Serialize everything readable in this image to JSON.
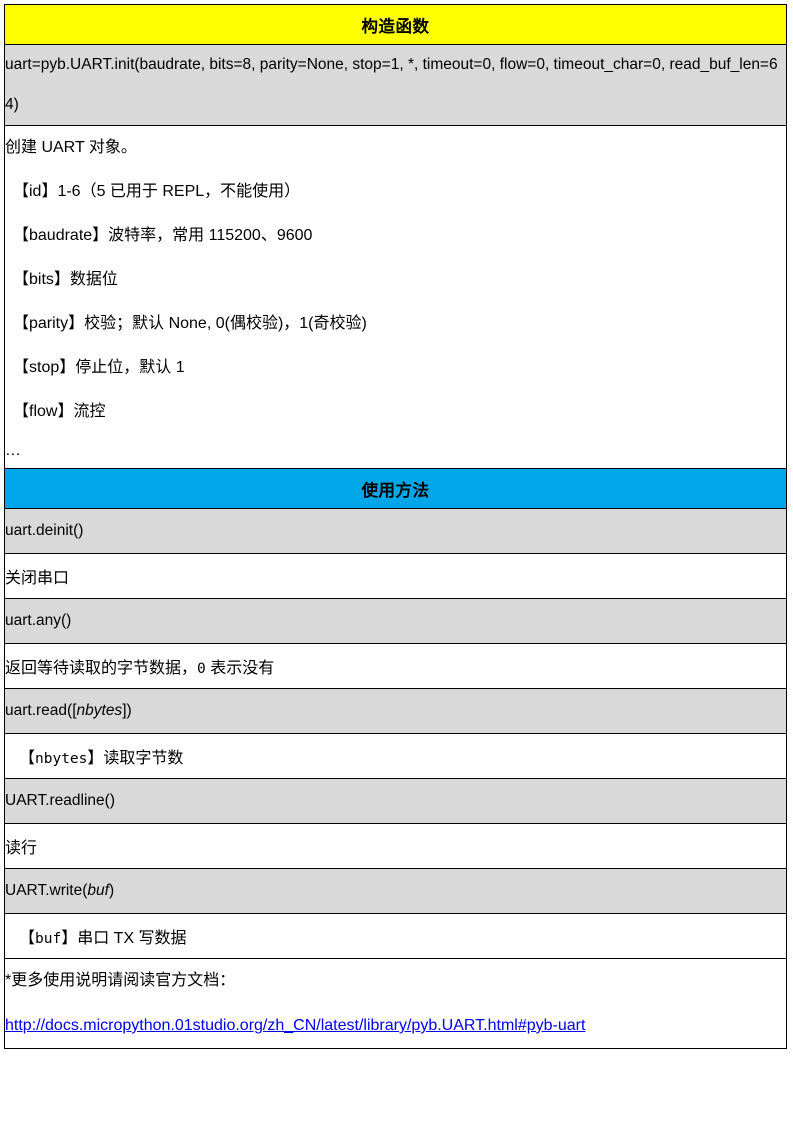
{
  "document": {
    "title": "pyb.UART API reference table",
    "accent_yellow": "#FFFF00",
    "accent_blue": "#00A7E8",
    "row_gray": "#D9D9D9",
    "link_color": "#0000EE"
  },
  "constructor_section": {
    "band_label": "构造函数",
    "signature": "uart=pyb.UART.init(baudrate, bits=8, parity=None, stop=1, *, timeout=0, flow=0, timeout_char=0, read_buf_len=64)",
    "description_intro": "创建 UART 对象。",
    "params": [
      "【id】1-6（5 已用于 REPL，不能使用）",
      "【baudrate】波特率，常用 115200、9600",
      "【bits】数据位",
      "【parity】校验；默认 None, 0(偶校验)，1(奇校验)",
      "【stop】停止位，默认 1",
      "【flow】流控"
    ],
    "more_ellipsis": "…"
  },
  "usage_section": {
    "band_label": "使用方法",
    "methods": [
      {
        "code_prefix": "uart.deinit()",
        "code_italic": "",
        "code_suffix": "",
        "note": "关闭串口",
        "note_mono": "",
        "note_suffix": "",
        "note_indent": false
      },
      {
        "code_prefix": "uart.any()",
        "code_italic": "",
        "code_suffix": "",
        "note": "返回等待读取的字节数据，",
        "note_mono": "0",
        "note_suffix": " 表示没有",
        "note_indent": false
      },
      {
        "code_prefix": "uart.read([",
        "code_italic": "nbytes",
        "code_suffix": "])",
        "note": "【",
        "note_mono": "nbytes",
        "note_suffix": "】读取字节数",
        "note_indent": true
      },
      {
        "code_prefix": "UART.readline()",
        "code_italic": "",
        "code_suffix": "",
        "note": "读行",
        "note_mono": "",
        "note_suffix": "",
        "note_indent": false
      },
      {
        "code_prefix": "UART.write(",
        "code_italic": "buf",
        "code_suffix": ")",
        "note": "【",
        "note_mono": "buf",
        "note_suffix": "】串口 TX 写数据",
        "note_indent": true
      }
    ]
  },
  "footer": {
    "note": "*更多使用说明请阅读官方文档：",
    "link_text": "http://docs.micropython.01studio.org/zh_CN/latest/library/pyb.UART.html#pyb-uart"
  }
}
